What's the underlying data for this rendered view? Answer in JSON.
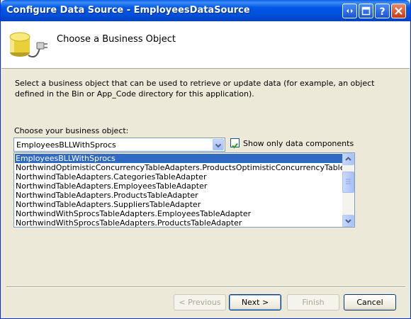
{
  "window": {
    "title": "Configure Data Source - EmployeesDataSource",
    "controls": [
      "restore-help-icon",
      "maximize-icon",
      "help-icon",
      "close-icon"
    ]
  },
  "header": {
    "title": "Choose a Business Object",
    "icon": "database-plug-icon"
  },
  "description": "Select a business object that can be used to retrieve or update data (for example, an object defined in the Bin or App_Code directory for this application).",
  "business_object": {
    "label": "Choose your business object:",
    "selected_value": "EmployeesBLLWithSprocs"
  },
  "filter_checkbox": {
    "label": "Show only data components",
    "checked": true
  },
  "object_list": {
    "items": [
      "EmployeesBLLWithSprocs",
      "NorthwindOptimisticConcurrencyTableAdapters.ProductsOptimisticConcurrencyTableAdapter",
      "NorthwindTableAdapters.CategoriesTableAdapter",
      "NorthwindTableAdapters.EmployeesTableAdapter",
      "NorthwindTableAdapters.ProductsTableAdapter",
      "NorthwindTableAdapters.SuppliersTableAdapter",
      "NorthwindWithSprocsTableAdapters.EmployeesTableAdapter",
      "NorthwindWithSprocsTableAdapters.ProductsTableAdapter"
    ],
    "selected_index": 0
  },
  "buttons": {
    "previous": "< Previous",
    "next": "Next >",
    "finish": "Finish",
    "cancel": "Cancel"
  },
  "colors": {
    "title_bar": "#0054e3",
    "selection": "#316ac5",
    "dialog_bg": "#ece9d8"
  }
}
